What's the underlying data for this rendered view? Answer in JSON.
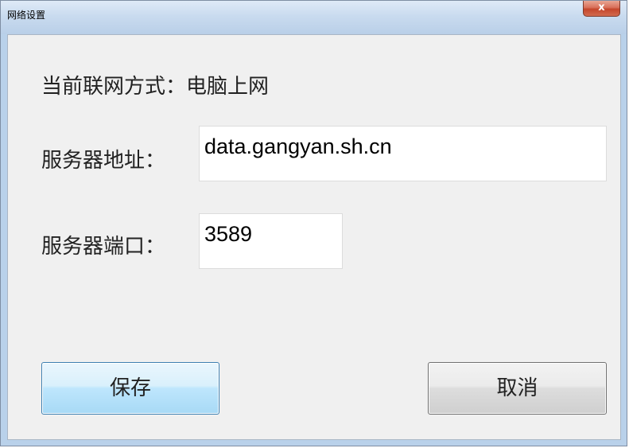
{
  "window": {
    "title": "网络设置",
    "close_glyph": "x"
  },
  "status": {
    "label": "当前联网方式：电脑上网"
  },
  "server_address": {
    "label": "服务器地址：",
    "value": "data.gangyan.sh.cn"
  },
  "server_port": {
    "label": "服务器端口：",
    "value": "3589"
  },
  "buttons": {
    "save_label": "保存",
    "cancel_label": "取消"
  },
  "colors": {
    "client_background": "#f0f0f0",
    "save_button_border": "#3c7fb1",
    "close_button": "#c4462c"
  }
}
